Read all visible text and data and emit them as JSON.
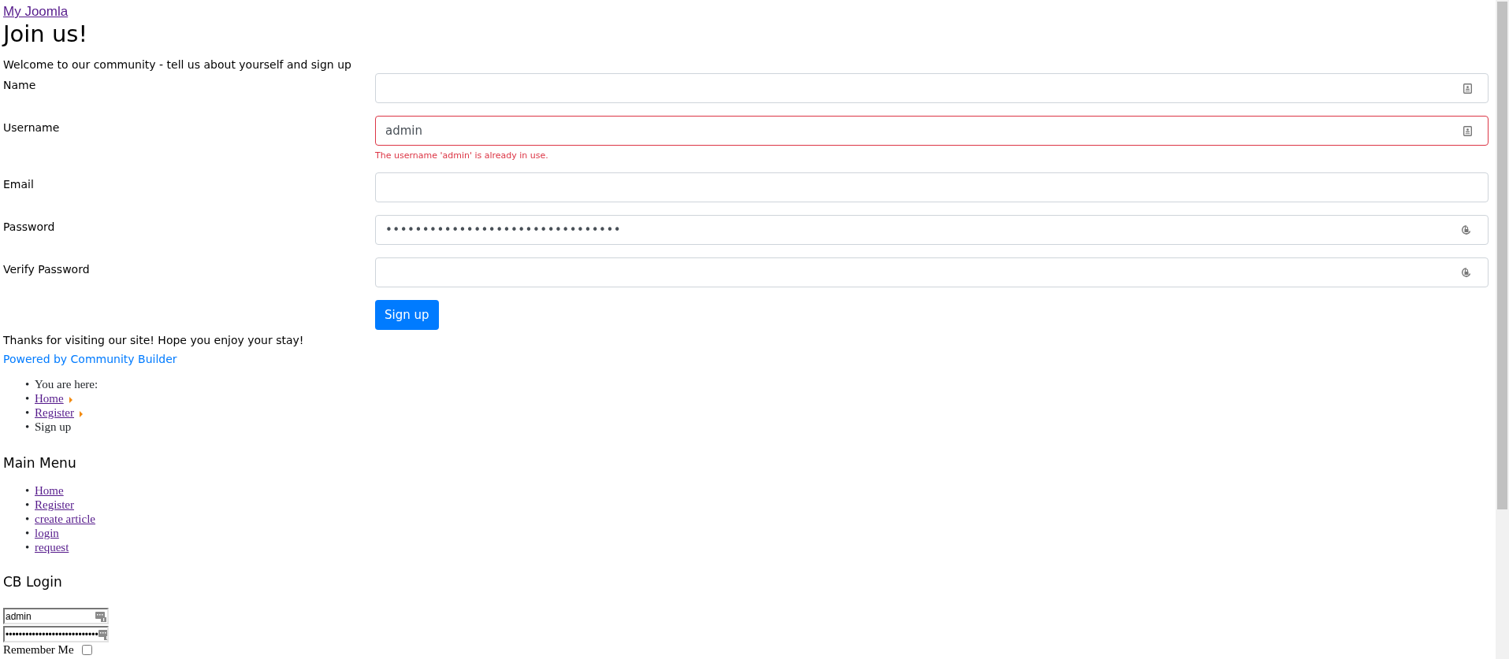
{
  "site_link": "My Joomla",
  "title": "Join us!",
  "intro": "Welcome to our community - tell us about yourself and sign up",
  "fields": [
    {
      "label": "Name",
      "kind": "identity",
      "invalid": false
    },
    {
      "label": "Username",
      "kind": "identity",
      "value": "admin",
      "invalid": true,
      "error": "The username 'admin' is already in use."
    },
    {
      "label": "Email",
      "kind": "email",
      "invalid": false
    },
    {
      "label": "Password",
      "kind": "password",
      "value": "••••••••••••••••••••••••••••••••",
      "invalid": false
    },
    {
      "label": "Verify Password",
      "kind": "password",
      "invalid": false
    }
  ],
  "submit_button": "Sign up",
  "closing_text": "Thanks for visiting our site! Hope you enjoy your stay!",
  "powered_by": "Powered by Community Builder",
  "breadcrumbs": [
    {
      "bullet": "•",
      "label": "You are here:",
      "kind": "text"
    },
    {
      "bullet": "•",
      "label": "Home",
      "kind": "link"
    },
    {
      "bullet": "•",
      "label": "Register",
      "kind": "link"
    },
    {
      "bullet": "•",
      "label": "Sign up",
      "kind": "text"
    }
  ],
  "main_menu": {
    "title": "Main Menu",
    "items": [
      {
        "bullet": "•",
        "label": "Home"
      },
      {
        "bullet": "•",
        "label": "Register"
      },
      {
        "bullet": "•",
        "label": "create article"
      },
      {
        "bullet": "•",
        "label": "login"
      },
      {
        "bullet": "•",
        "label": "request"
      }
    ]
  },
  "cb_login": {
    "title": "CB Login",
    "username": "admin",
    "password": "••••••••••••••••••••••••••••",
    "remember_label": "Remember Me",
    "remember_checked": false
  }
}
